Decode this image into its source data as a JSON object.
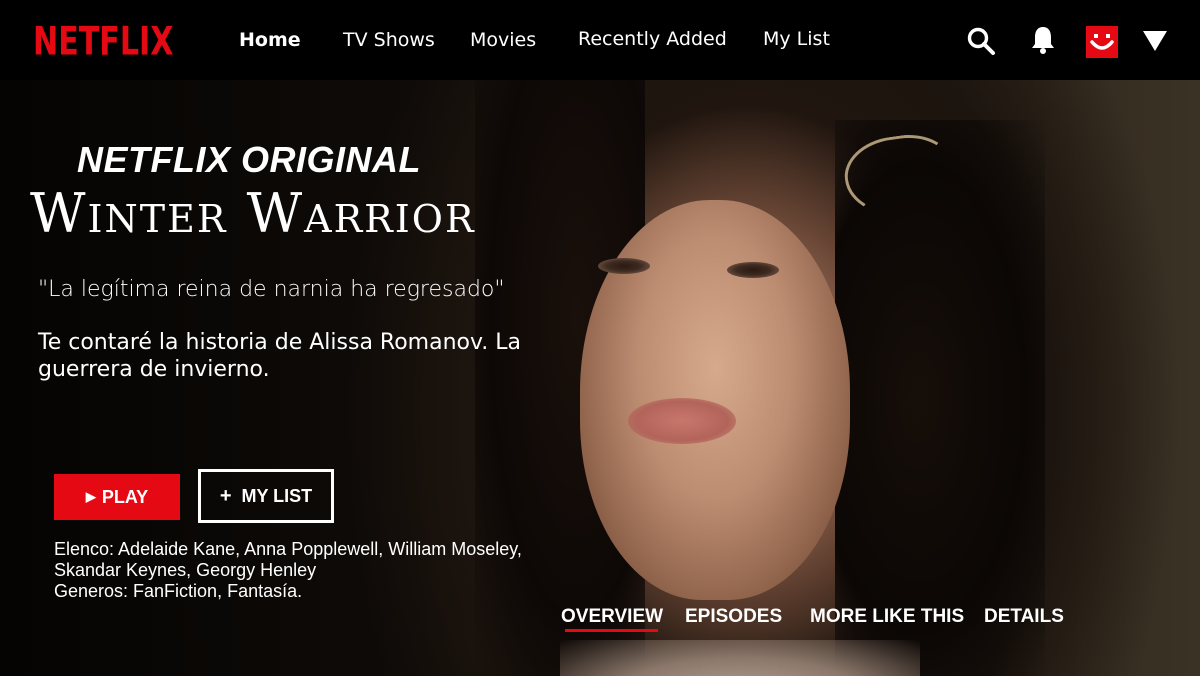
{
  "brand": {
    "logo": "NETFLIX",
    "accent": "#e50914"
  },
  "nav": {
    "items": [
      {
        "label": "Home",
        "active": true
      },
      {
        "label": "TV Shows"
      },
      {
        "label": "Movies"
      },
      {
        "label": "Recently Added"
      },
      {
        "label": "My List"
      }
    ],
    "icons": [
      "search-icon",
      "bell-icon",
      "avatar",
      "caret-down-icon"
    ]
  },
  "hero": {
    "badge": "NETFLIX ORIGINAL",
    "title": "Winter Warrior",
    "tagline": "\"La legítima reina de narnia ha regresado\"",
    "synopsis": "Te contaré la historia de Alissa Romanov. La guerrera de invierno.",
    "play_label": "PLAY",
    "play_icon": "play-icon",
    "mylist_label": "MY LIST",
    "mylist_icon": "plus-icon",
    "cast": "Elenco: Adelaide Kane, Anna Popplewell, William Moseley, Skandar Keynes, Georgy Henley",
    "genres": "Generos: FanFiction, Fantasía."
  },
  "tabs": [
    {
      "label": "OVERVIEW",
      "active": true
    },
    {
      "label": "EPISODES"
    },
    {
      "label": "MORE LIKE THIS"
    },
    {
      "label": "DETAILS"
    }
  ]
}
